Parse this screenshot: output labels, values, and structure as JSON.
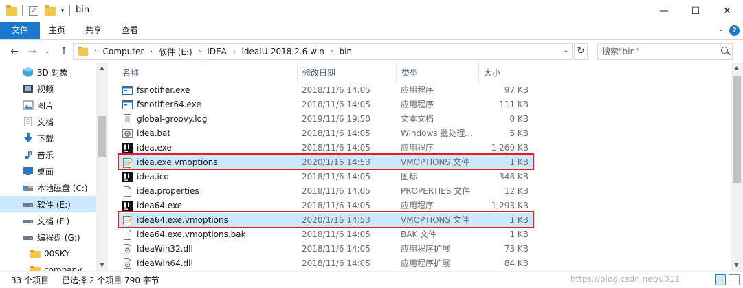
{
  "window": {
    "title": "bin",
    "minimize_glyph": "—",
    "maximize_glyph": "☐",
    "close_glyph": "✕"
  },
  "ribbon": {
    "tabs": [
      {
        "label": "文件",
        "active": true
      },
      {
        "label": "主页"
      },
      {
        "label": "共享"
      },
      {
        "label": "查看"
      }
    ],
    "help_glyph": "?",
    "expand_glyph": "⌄"
  },
  "address": {
    "back_glyph": "←",
    "forward_glyph": "→",
    "recent_glyph": "⌄",
    "up_glyph": "↑",
    "crumbs": [
      "Computer",
      "软件 (E:)",
      "IDEA",
      "ideaIU-2018.2.6.win",
      "bin"
    ],
    "separator": "›",
    "dropdown_glyph": "⌄",
    "refresh_glyph": "↻",
    "search_placeholder": "搜索\"bin\""
  },
  "navpane": {
    "items": [
      {
        "label": "3D 对象",
        "icon": "3d-objects-icon"
      },
      {
        "label": "视频",
        "icon": "video-icon"
      },
      {
        "label": "图片",
        "icon": "pictures-icon"
      },
      {
        "label": "文档",
        "icon": "documents-icon"
      },
      {
        "label": "下载",
        "icon": "download-icon"
      },
      {
        "label": "音乐",
        "icon": "music-icon"
      },
      {
        "label": "桌面",
        "icon": "desktop-icon"
      },
      {
        "label": "本地磁盘 (C:)",
        "icon": "drive-icon"
      },
      {
        "label": "软件 (E:)",
        "icon": "drive-icon",
        "selected": true
      },
      {
        "label": "文档 (F:)",
        "icon": "drive-icon"
      },
      {
        "label": "编程盘 (G:)",
        "icon": "drive-icon"
      },
      {
        "label": "00SKY",
        "icon": "folder-icon"
      },
      {
        "label": "company",
        "icon": "folder-icon"
      }
    ]
  },
  "columns": {
    "name": "名称",
    "date": "修改日期",
    "type": "类型",
    "size": "大小"
  },
  "files": [
    {
      "name": "fsnotifier.exe",
      "date": "2018/11/6 14:05",
      "type": "应用程序",
      "size": "97 KB",
      "icon": "exe-window-icon"
    },
    {
      "name": "fsnotifier64.exe",
      "date": "2018/11/6 14:05",
      "type": "应用程序",
      "size": "111 KB",
      "icon": "exe-window-icon"
    },
    {
      "name": "global-groovy.log",
      "date": "2019/11/6 19:50",
      "type": "文本文档",
      "size": "0 KB",
      "icon": "text-file-icon"
    },
    {
      "name": "idea.bat",
      "date": "2018/11/6 14:05",
      "type": "Windows 批处理...",
      "size": "5 KB",
      "icon": "batch-file-icon"
    },
    {
      "name": "idea.exe",
      "date": "2018/11/6 14:05",
      "type": "应用程序",
      "size": "1,269 KB",
      "icon": "intellij-icon"
    },
    {
      "name": "idea.exe.vmoptions",
      "date": "2020/1/16 14:53",
      "type": "VMOPTIONS 文件",
      "size": "1 KB",
      "icon": "notepad-file-icon",
      "selected": true
    },
    {
      "name": "idea.ico",
      "date": "2018/11/6 14:05",
      "type": "图标",
      "size": "348 KB",
      "icon": "intellij-icon"
    },
    {
      "name": "idea.properties",
      "date": "2018/11/6 14:05",
      "type": "PROPERTIES 文件",
      "size": "12 KB",
      "icon": "blank-file-icon"
    },
    {
      "name": "idea64.exe",
      "date": "2018/11/6 14:05",
      "type": "应用程序",
      "size": "1,293 KB",
      "icon": "intellij-icon"
    },
    {
      "name": "idea64.exe.vmoptions",
      "date": "2020/1/16 14:53",
      "type": "VMOPTIONS 文件",
      "size": "1 KB",
      "icon": "notepad-file-icon",
      "selected": true
    },
    {
      "name": "idea64.exe.vmoptions.bak",
      "date": "2018/11/6 14:05",
      "type": "BAK 文件",
      "size": "1 KB",
      "icon": "blank-file-icon"
    },
    {
      "name": "IdeaWin32.dll",
      "date": "2018/11/6 14:05",
      "type": "应用程序扩展",
      "size": "73 KB",
      "icon": "dll-file-icon"
    },
    {
      "name": "IdeaWin64.dll",
      "date": "2018/11/6 14:05",
      "type": "应用程序扩展",
      "size": "84 KB",
      "icon": "dll-file-icon"
    }
  ],
  "status": {
    "item_count": "33 个项目",
    "selected": "已选择 2 个项目  790 字节",
    "watermark": "https://blog.csdn.net/u011"
  },
  "colors": {
    "accent": "#1979ca",
    "selection": "#cce8ff",
    "highlight_border": "#e02020"
  }
}
